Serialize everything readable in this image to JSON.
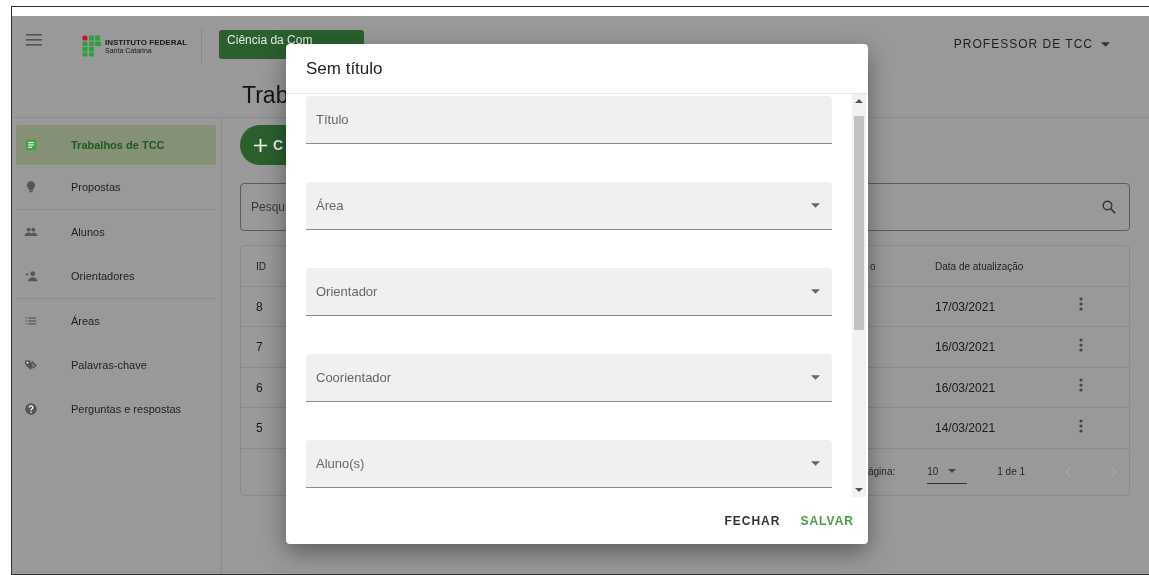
{
  "app_bar": {
    "logo_title": "INSTITUTO FEDERAL",
    "logo_subtitle": "Santa Catarina",
    "course": "Ciência da Com",
    "user": "PROFESSOR DE TCC"
  },
  "page_title": "Trab",
  "sidebar": {
    "groups": [
      [
        {
          "label": "Trabalhos de TCC",
          "selected": true
        },
        {
          "label": "Propostas",
          "selected": false
        }
      ],
      [
        {
          "label": "Alunos",
          "selected": false
        },
        {
          "label": "Orientadores",
          "selected": false
        }
      ],
      [
        {
          "label": "Áreas",
          "selected": false
        },
        {
          "label": "Palavras-chave",
          "selected": false
        },
        {
          "label": "Perguntas e respostas",
          "selected": false
        }
      ]
    ]
  },
  "create_button": "C",
  "search": {
    "placeholder": "Pesqu"
  },
  "table": {
    "columns": [
      "ID",
      "o",
      "Data de atualização"
    ],
    "rows": [
      {
        "id": "8",
        "date": "17/03/2021"
      },
      {
        "id": "7",
        "date": "16/03/2021"
      },
      {
        "id": "6",
        "date": "16/03/2021"
      },
      {
        "id": "5",
        "date": "14/03/2021"
      }
    ],
    "pagination": {
      "rows_label": "ágina:",
      "per_page": "10",
      "range": "1 de 1"
    }
  },
  "dialog": {
    "title": "Sem título",
    "fields": [
      {
        "label": "Título",
        "kind": "text"
      },
      {
        "label": "Área",
        "kind": "select"
      },
      {
        "label": "Orientador",
        "kind": "select"
      },
      {
        "label": "Coorientador",
        "kind": "select"
      },
      {
        "label": "Aluno(s)",
        "kind": "select"
      }
    ],
    "buttons": [
      {
        "label": "FECHAR",
        "kind": "secondary"
      },
      {
        "label": "SALVAR",
        "kind": "primary"
      }
    ]
  }
}
